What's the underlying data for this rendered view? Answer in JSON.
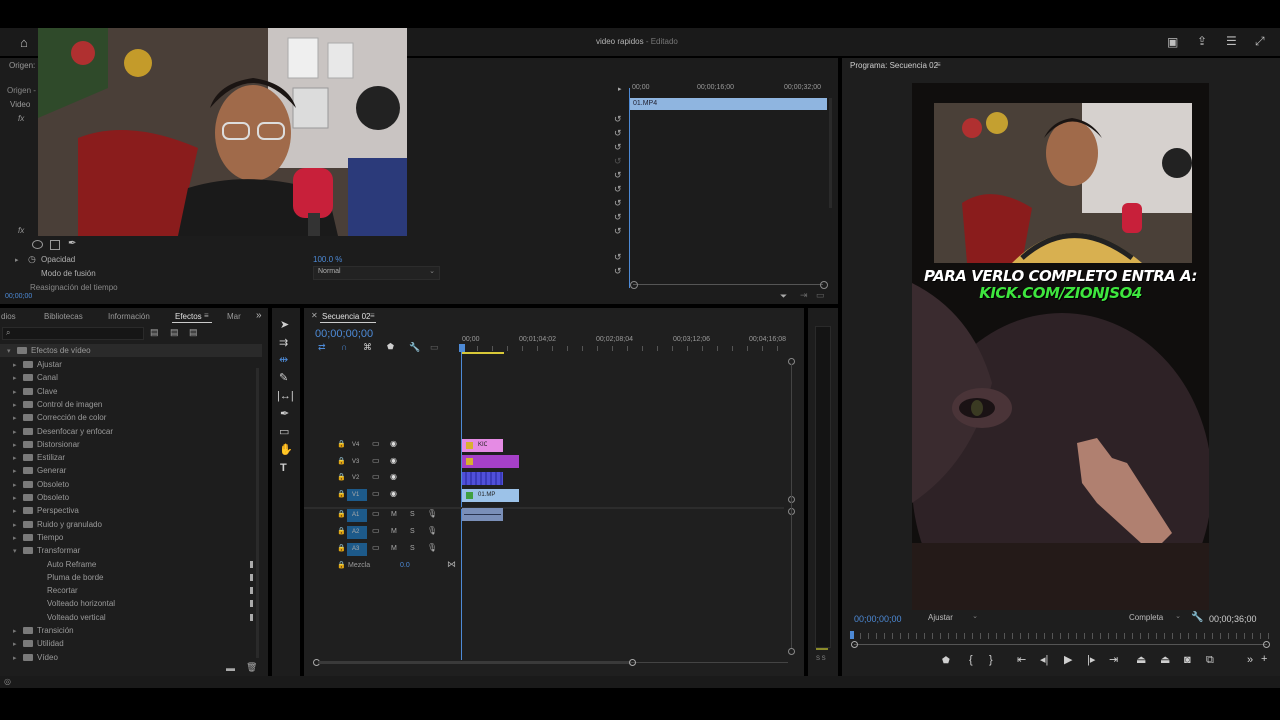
{
  "app": {
    "title": "video rapidos",
    "status": "Editado"
  },
  "source_panel": {
    "origin_label": "Origen: (",
    "origin_label2": "Origen - (",
    "video_label": "Video",
    "opacity_label": "Opacidad",
    "opacity_value": "100.0 %",
    "blend_mode_label": "Modo de fusión",
    "blend_mode_value": "Normal",
    "time_remap_label": "Reasignación del tiempo",
    "timecode": "00;00;00",
    "ruler": [
      "00;00",
      "00;00;16;00",
      "00;00;32;00"
    ],
    "clip_name": "01.MP4"
  },
  "program_panel": {
    "title": "Programa: Secuencia 02",
    "timecode_current": "00;00;00;00",
    "fit_value": "Ajustar",
    "quality_value": "Completa",
    "timecode_total": "00;00;36;00",
    "overlay_line1": "PARA VERLO COMPLETO ENTRA A:",
    "overlay_line2": "KICK.COM/ZIONJSO4"
  },
  "effects_panel": {
    "tabs": [
      "dios",
      "Bibliotecas",
      "Información",
      "Efectos",
      "Mar"
    ],
    "root": "Efectos de vídeo",
    "items": [
      {
        "label": "Ajustar",
        "level": 1,
        "open": false
      },
      {
        "label": "Canal",
        "level": 1,
        "open": false
      },
      {
        "label": "Clave",
        "level": 1,
        "open": false
      },
      {
        "label": "Control de imagen",
        "level": 1,
        "open": false
      },
      {
        "label": "Corrección de color",
        "level": 1,
        "open": false
      },
      {
        "label": "Desenfocar y enfocar",
        "level": 1,
        "open": false
      },
      {
        "label": "Distorsionar",
        "level": 1,
        "open": false
      },
      {
        "label": "Estilizar",
        "level": 1,
        "open": false
      },
      {
        "label": "Generar",
        "level": 1,
        "open": false
      },
      {
        "label": "Obsoleto",
        "level": 1,
        "open": false
      },
      {
        "label": "Obsoleto",
        "level": 1,
        "open": false
      },
      {
        "label": "Perspectiva",
        "level": 1,
        "open": false
      },
      {
        "label": "Ruido y granulado",
        "level": 1,
        "open": false
      },
      {
        "label": "Tiempo",
        "level": 1,
        "open": false
      },
      {
        "label": "Transformar",
        "level": 1,
        "open": true
      },
      {
        "label": "Auto Reframe",
        "level": 2,
        "open": false
      },
      {
        "label": "Pluma de borde",
        "level": 2,
        "open": false
      },
      {
        "label": "Recortar",
        "level": 2,
        "open": false
      },
      {
        "label": "Volteado horizontal",
        "level": 2,
        "open": false
      },
      {
        "label": "Volteado vertical",
        "level": 2,
        "open": false
      },
      {
        "label": "Transición",
        "level": 1,
        "open": false
      },
      {
        "label": "Utilidad",
        "level": 1,
        "open": false
      },
      {
        "label": "Vídeo",
        "level": 1,
        "open": false
      }
    ]
  },
  "timeline": {
    "tab": "Secuencia 02",
    "timecode": "00;00;00;00",
    "ruler": [
      "00;00",
      "00;01;04;02",
      "00;02;08;04",
      "00;03;12;06",
      "00;04;16;08"
    ],
    "video_tracks": [
      "V4",
      "V3",
      "V2",
      "V1"
    ],
    "audio_tracks": [
      "A1",
      "A2",
      "A3"
    ],
    "mix_label": "Mezcla",
    "mix_value": "0.0",
    "clips": {
      "v4": "KICK02",
      "v1": "01.MP"
    },
    "meter_labels": "S S"
  },
  "colors": {
    "accent": "#4d8ad6",
    "clip_pink": "#e58be4",
    "clip_magenta": "#a640c8",
    "clip_blue": "#5050d8",
    "clip_lightblue": "#9cc2e8"
  }
}
